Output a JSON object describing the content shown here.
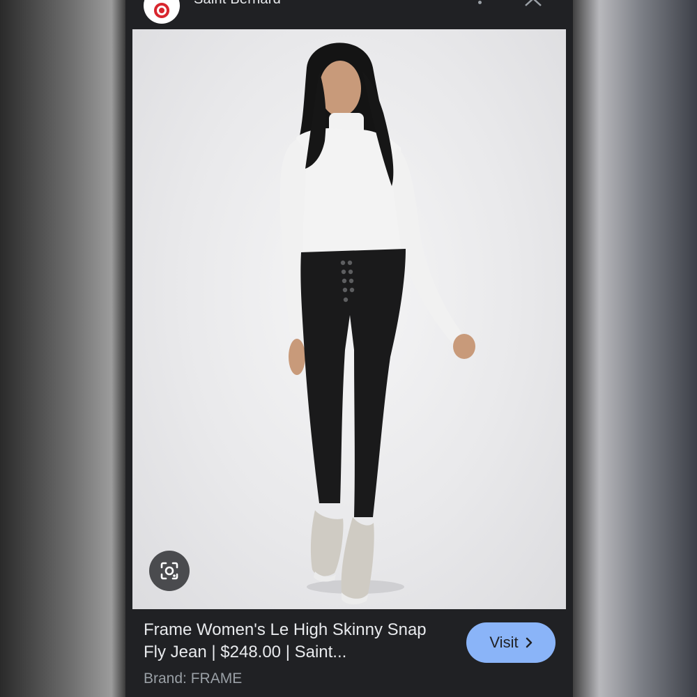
{
  "header": {
    "site_name": "Saint Bernard",
    "site_logo_icon": "saint-bernard-logo",
    "more_icon": "more-vert-icon",
    "close_icon": "close-icon"
  },
  "image": {
    "alt": "Woman wearing white turtleneck and black high skinny snap fly jeans with grey sneakers",
    "lens_icon": "google-lens-icon"
  },
  "result": {
    "title": "Frame Women's Le High Skinny Snap Fly Jean | $248.00 | Saint...",
    "brand": "Brand: FRAME",
    "visit_label": "Visit",
    "visit_icon": "chevron-right-icon"
  },
  "colors": {
    "panel": "#202124",
    "visit_button": "#8ab4f8",
    "text_primary": "#e8eaed",
    "text_secondary": "#9aa0a6"
  }
}
